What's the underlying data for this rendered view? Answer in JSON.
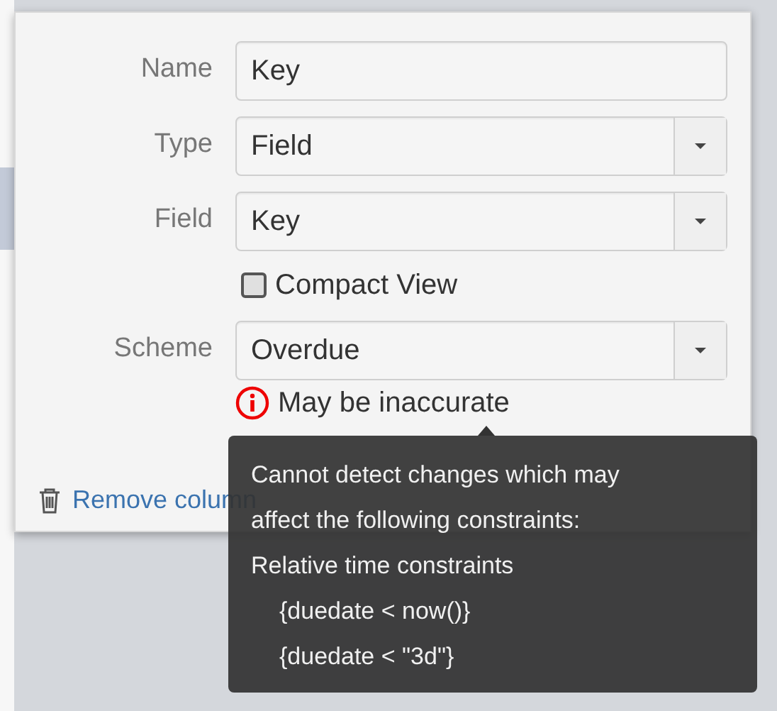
{
  "form": {
    "fields": [
      {
        "kind": "text",
        "label": "Name",
        "value": "Key"
      },
      {
        "kind": "select",
        "label": "Type",
        "value": "Field"
      },
      {
        "kind": "select",
        "label": "Field",
        "value": "Key"
      },
      {
        "kind": "checkbox",
        "label": "Compact View",
        "checked": false
      },
      {
        "kind": "select",
        "label": "Scheme",
        "value": "Overdue"
      }
    ],
    "warning": "May be inaccurate",
    "actions": [
      {
        "kind": "remove",
        "label": "Remove column"
      }
    ]
  },
  "tooltip": {
    "lines": [
      "Cannot detect changes which may",
      "affect the following constraints:",
      "Relative time constraints"
    ],
    "constraints": [
      "{duedate < now()}",
      "{duedate < \"3d\"}"
    ]
  }
}
